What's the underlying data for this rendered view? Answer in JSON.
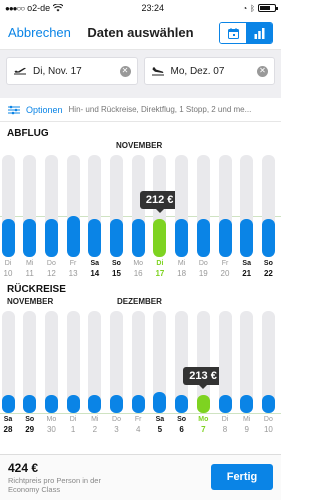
{
  "status_bar": {
    "carrier": "o2-de",
    "time": "23:24"
  },
  "header": {
    "cancel_label": "Abbrechen",
    "title": "Daten auswählen",
    "view_toggle": [
      "calendar-icon",
      "bar-chart-icon"
    ],
    "active_view": "bar-chart"
  },
  "date_fields": {
    "outbound": {
      "icon": "plane-departure-icon",
      "value": "Di, Nov. 17"
    },
    "return": {
      "icon": "plane-arrival-icon",
      "value": "Mo, Dez. 07"
    }
  },
  "options": {
    "label": "Optionen",
    "summary": "Hin- und Rückreise, Direktflug, 1 Stopp, 2 und me..."
  },
  "colors": {
    "accent": "#0a84e6",
    "selected": "#7ed321",
    "track": "#e9e9ec"
  },
  "outbound_chart": {
    "section_title": "ABFLUG",
    "months": [
      "NOVEMBER"
    ],
    "selected_price": "212 €",
    "days": [
      {
        "dow": "Di",
        "day": "10",
        "level": 0.37,
        "weekend": false,
        "selected": false
      },
      {
        "dow": "Mi",
        "day": "11",
        "level": 0.37,
        "weekend": false,
        "selected": false
      },
      {
        "dow": "Do",
        "day": "12",
        "level": 0.37,
        "weekend": false,
        "selected": false
      },
      {
        "dow": "Fr",
        "day": "13",
        "level": 0.4,
        "weekend": false,
        "selected": false
      },
      {
        "dow": "Sa",
        "day": "14",
        "level": 0.37,
        "weekend": true,
        "selected": false
      },
      {
        "dow": "So",
        "day": "15",
        "level": 0.37,
        "weekend": true,
        "selected": false
      },
      {
        "dow": "Mo",
        "day": "16",
        "level": 0.37,
        "weekend": false,
        "selected": false
      },
      {
        "dow": "Di",
        "day": "17",
        "level": 0.37,
        "weekend": false,
        "selected": true
      },
      {
        "dow": "Mi",
        "day": "18",
        "level": 0.37,
        "weekend": false,
        "selected": false
      },
      {
        "dow": "Do",
        "day": "19",
        "level": 0.37,
        "weekend": false,
        "selected": false
      },
      {
        "dow": "Fr",
        "day": "20",
        "level": 0.37,
        "weekend": false,
        "selected": false
      },
      {
        "dow": "Sa",
        "day": "21",
        "level": 0.37,
        "weekend": true,
        "selected": false
      },
      {
        "dow": "So",
        "day": "22",
        "level": 0.37,
        "weekend": true,
        "selected": false
      }
    ]
  },
  "return_chart": {
    "section_title": "RÜCKREISE",
    "months": [
      "NOVEMBER",
      "DEZEMBER"
    ],
    "selected_price": "213 €",
    "days": [
      {
        "dow": "Sa",
        "day": "28",
        "level": 0.18,
        "weekend": true,
        "selected": false
      },
      {
        "dow": "So",
        "day": "29",
        "level": 0.18,
        "weekend": true,
        "selected": false
      },
      {
        "dow": "Mo",
        "day": "30",
        "level": 0.18,
        "weekend": false,
        "selected": false
      },
      {
        "dow": "Di",
        "day": "1",
        "level": 0.18,
        "weekend": false,
        "selected": false
      },
      {
        "dow": "Mi",
        "day": "2",
        "level": 0.18,
        "weekend": false,
        "selected": false
      },
      {
        "dow": "Do",
        "day": "3",
        "level": 0.18,
        "weekend": false,
        "selected": false
      },
      {
        "dow": "Fr",
        "day": "4",
        "level": 0.18,
        "weekend": false,
        "selected": false
      },
      {
        "dow": "Sa",
        "day": "5",
        "level": 0.21,
        "weekend": true,
        "selected": false
      },
      {
        "dow": "So",
        "day": "6",
        "level": 0.18,
        "weekend": true,
        "selected": false
      },
      {
        "dow": "Mo",
        "day": "7",
        "level": 0.18,
        "weekend": false,
        "selected": true
      },
      {
        "dow": "Di",
        "day": "8",
        "level": 0.18,
        "weekend": false,
        "selected": false
      },
      {
        "dow": "Mi",
        "day": "9",
        "level": 0.18,
        "weekend": false,
        "selected": false
      },
      {
        "dow": "Do",
        "day": "10",
        "level": 0.18,
        "weekend": false,
        "selected": false
      }
    ]
  },
  "footer": {
    "price": "424 €",
    "note": "Richtpreis pro Person in der Economy Class",
    "done_label": "Fertig"
  }
}
